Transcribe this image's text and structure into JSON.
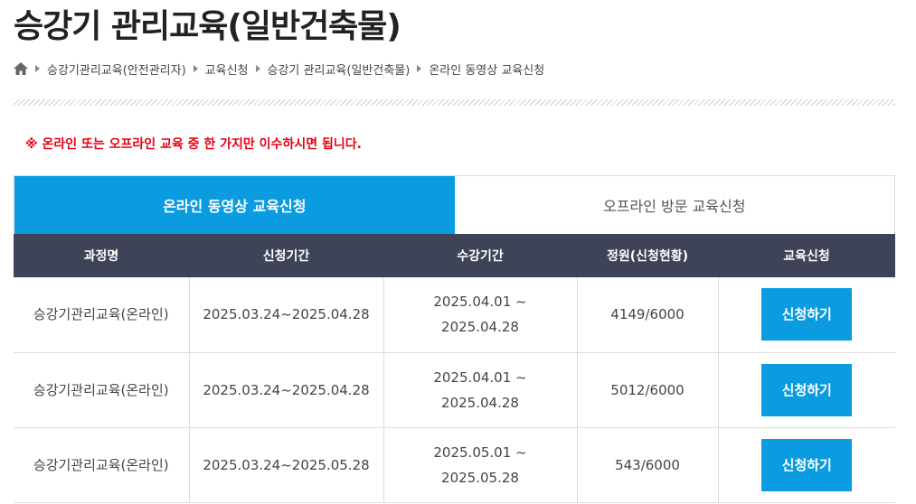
{
  "page": {
    "title": "승강기 관리교육(일반건축물)"
  },
  "breadcrumb": {
    "items": [
      "승강기관리교육(안전관리자)",
      "교육신청",
      "승강기 관리교육(일반건축물)",
      "온라인 동영상 교육신청"
    ]
  },
  "notice": "※ 온라인 또는 오프라인 교육 중 한 가지만 이수하시면 됩니다.",
  "tabs": [
    {
      "label": "온라인 동영상 교육신청",
      "active": true
    },
    {
      "label": "오프라인 방문 교육신청",
      "active": false
    }
  ],
  "table": {
    "headers": [
      "과정명",
      "신청기간",
      "수강기간",
      "정원(신청현황)",
      "교육신청"
    ],
    "rows": [
      {
        "name": "승강기관리교육(온라인)",
        "apply_period": "2025.03.24~2025.04.28",
        "study_start": "2025.04.01 ~",
        "study_end": "2025.04.28",
        "capacity": "4149/6000",
        "button": "신청하기"
      },
      {
        "name": "승강기관리교육(온라인)",
        "apply_period": "2025.03.24~2025.04.28",
        "study_start": "2025.04.01 ~",
        "study_end": "2025.04.28",
        "capacity": "5012/6000",
        "button": "신청하기"
      },
      {
        "name": "승강기관리교육(온라인)",
        "apply_period": "2025.03.24~2025.05.28",
        "study_start": "2025.05.01 ~",
        "study_end": "2025.05.28",
        "capacity": "543/6000",
        "button": "신청하기"
      }
    ]
  },
  "colors": {
    "accent": "#0a9be0",
    "header_bg": "#3e4357",
    "notice": "#e60012"
  }
}
